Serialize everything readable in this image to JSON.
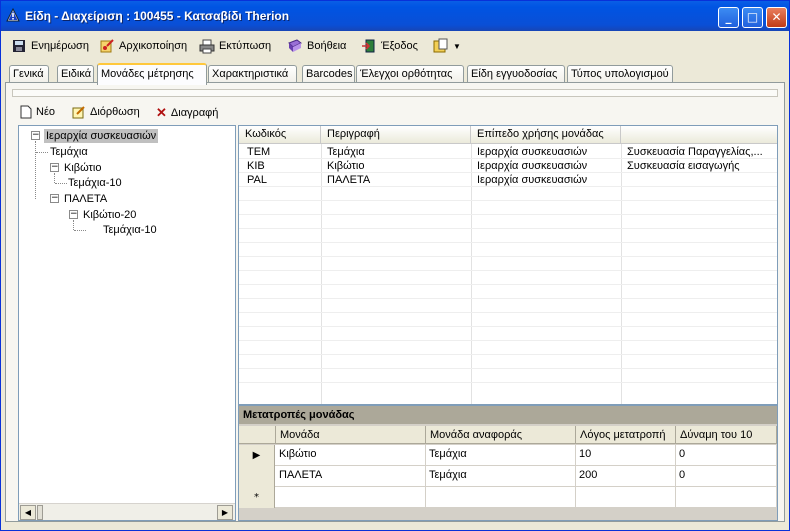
{
  "window": {
    "title": "Είδη - Διαχείριση : 100455 - Κατσαβίδι Therion"
  },
  "toolbar": [
    {
      "label": "Ενημέρωση",
      "icon": "save-icon"
    },
    {
      "label": "Αρχικοποίηση",
      "icon": "reset-icon"
    },
    {
      "label": "Εκτύπωση",
      "icon": "printer-icon"
    },
    {
      "label": "Βοήθεια",
      "icon": "help-book-icon"
    },
    {
      "label": "Έξοδος",
      "icon": "exit-icon"
    },
    {
      "label": "",
      "icon": "folder-menu-icon"
    }
  ],
  "tabs": [
    "Γενικά",
    "Ειδικά",
    "Μονάδες μέτρησης",
    "Χαρακτηριστικά",
    "Barcodes",
    "Έλεγχοι ορθότητας",
    "Είδη εγγυοδοσίας",
    "Τύπος υπολογισμού"
  ],
  "active_tab": "Μονάδες μέτρησης",
  "actions": {
    "new": "Νέο",
    "edit": "Διόρθωση",
    "delete": "Διαγραφή"
  },
  "tree": {
    "root": "Ιεραρχία συσκευασιών",
    "nodes": [
      "Τεμάχια",
      "Κιβώτιο",
      "Τεμάχια-10",
      "ΠΑΛΕΤΑ",
      "Κιβώτιο-20",
      "Τεμάχια-10"
    ]
  },
  "units_grid": {
    "headers": [
      "Κωδικός",
      "Περιγραφή",
      "Επίπεδο χρήσης μονάδας",
      ""
    ],
    "rows": [
      [
        "TEM",
        "Τεμάχια",
        "Ιεραρχία συσκευασιών",
        "Συσκευασία Παραγγελίας,..."
      ],
      [
        "KIB",
        "Κιβώτιο",
        "Ιεραρχία συσκευασιών",
        "Συσκευασία εισαγωγής"
      ],
      [
        "PAL",
        "ΠΑΛΕΤΑ",
        "Ιεραρχία συσκευασιών",
        ""
      ]
    ]
  },
  "conversions": {
    "title": "Μετατροπές μονάδας",
    "headers": [
      "Μονάδα",
      "Μονάδα αναφοράς",
      "Λόγος μετατροπή",
      "Δύναμη του 10"
    ],
    "rows": [
      [
        "Κιβώτιο",
        "Τεμάχια",
        "10",
        "0"
      ],
      [
        "ΠΑΛΕΤΑ",
        "Τεμάχια",
        "200",
        "0"
      ]
    ],
    "new_row_marker": "*",
    "current_row_marker": "▶"
  }
}
